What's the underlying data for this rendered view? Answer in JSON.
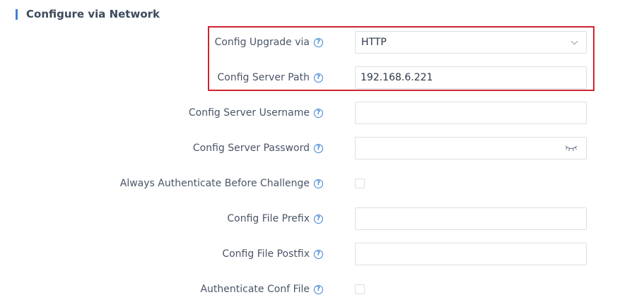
{
  "section": {
    "title": "Configure via Network"
  },
  "rows": [
    {
      "label": "Config Upgrade via",
      "type": "select",
      "value": "HTTP"
    },
    {
      "label": "Config Server Path",
      "type": "text",
      "value": "192.168.6.221"
    },
    {
      "label": "Config Server Username",
      "type": "text",
      "value": ""
    },
    {
      "label": "Config Server Password",
      "type": "password",
      "value": ""
    },
    {
      "label": "Always Authenticate Before Challenge",
      "type": "checkbox",
      "checked": false
    },
    {
      "label": "Config File Prefix",
      "type": "text",
      "value": ""
    },
    {
      "label": "Config File Postfix",
      "type": "text",
      "value": ""
    },
    {
      "label": "Authenticate Conf File",
      "type": "checkbox",
      "checked": false
    }
  ],
  "icons": {
    "help": "help-icon",
    "dropdown": "chevron-down-icon",
    "password_toggle": "eye-closed-icon"
  },
  "colors": {
    "accent": "#3b82d6",
    "highlight": "#d0242f"
  }
}
